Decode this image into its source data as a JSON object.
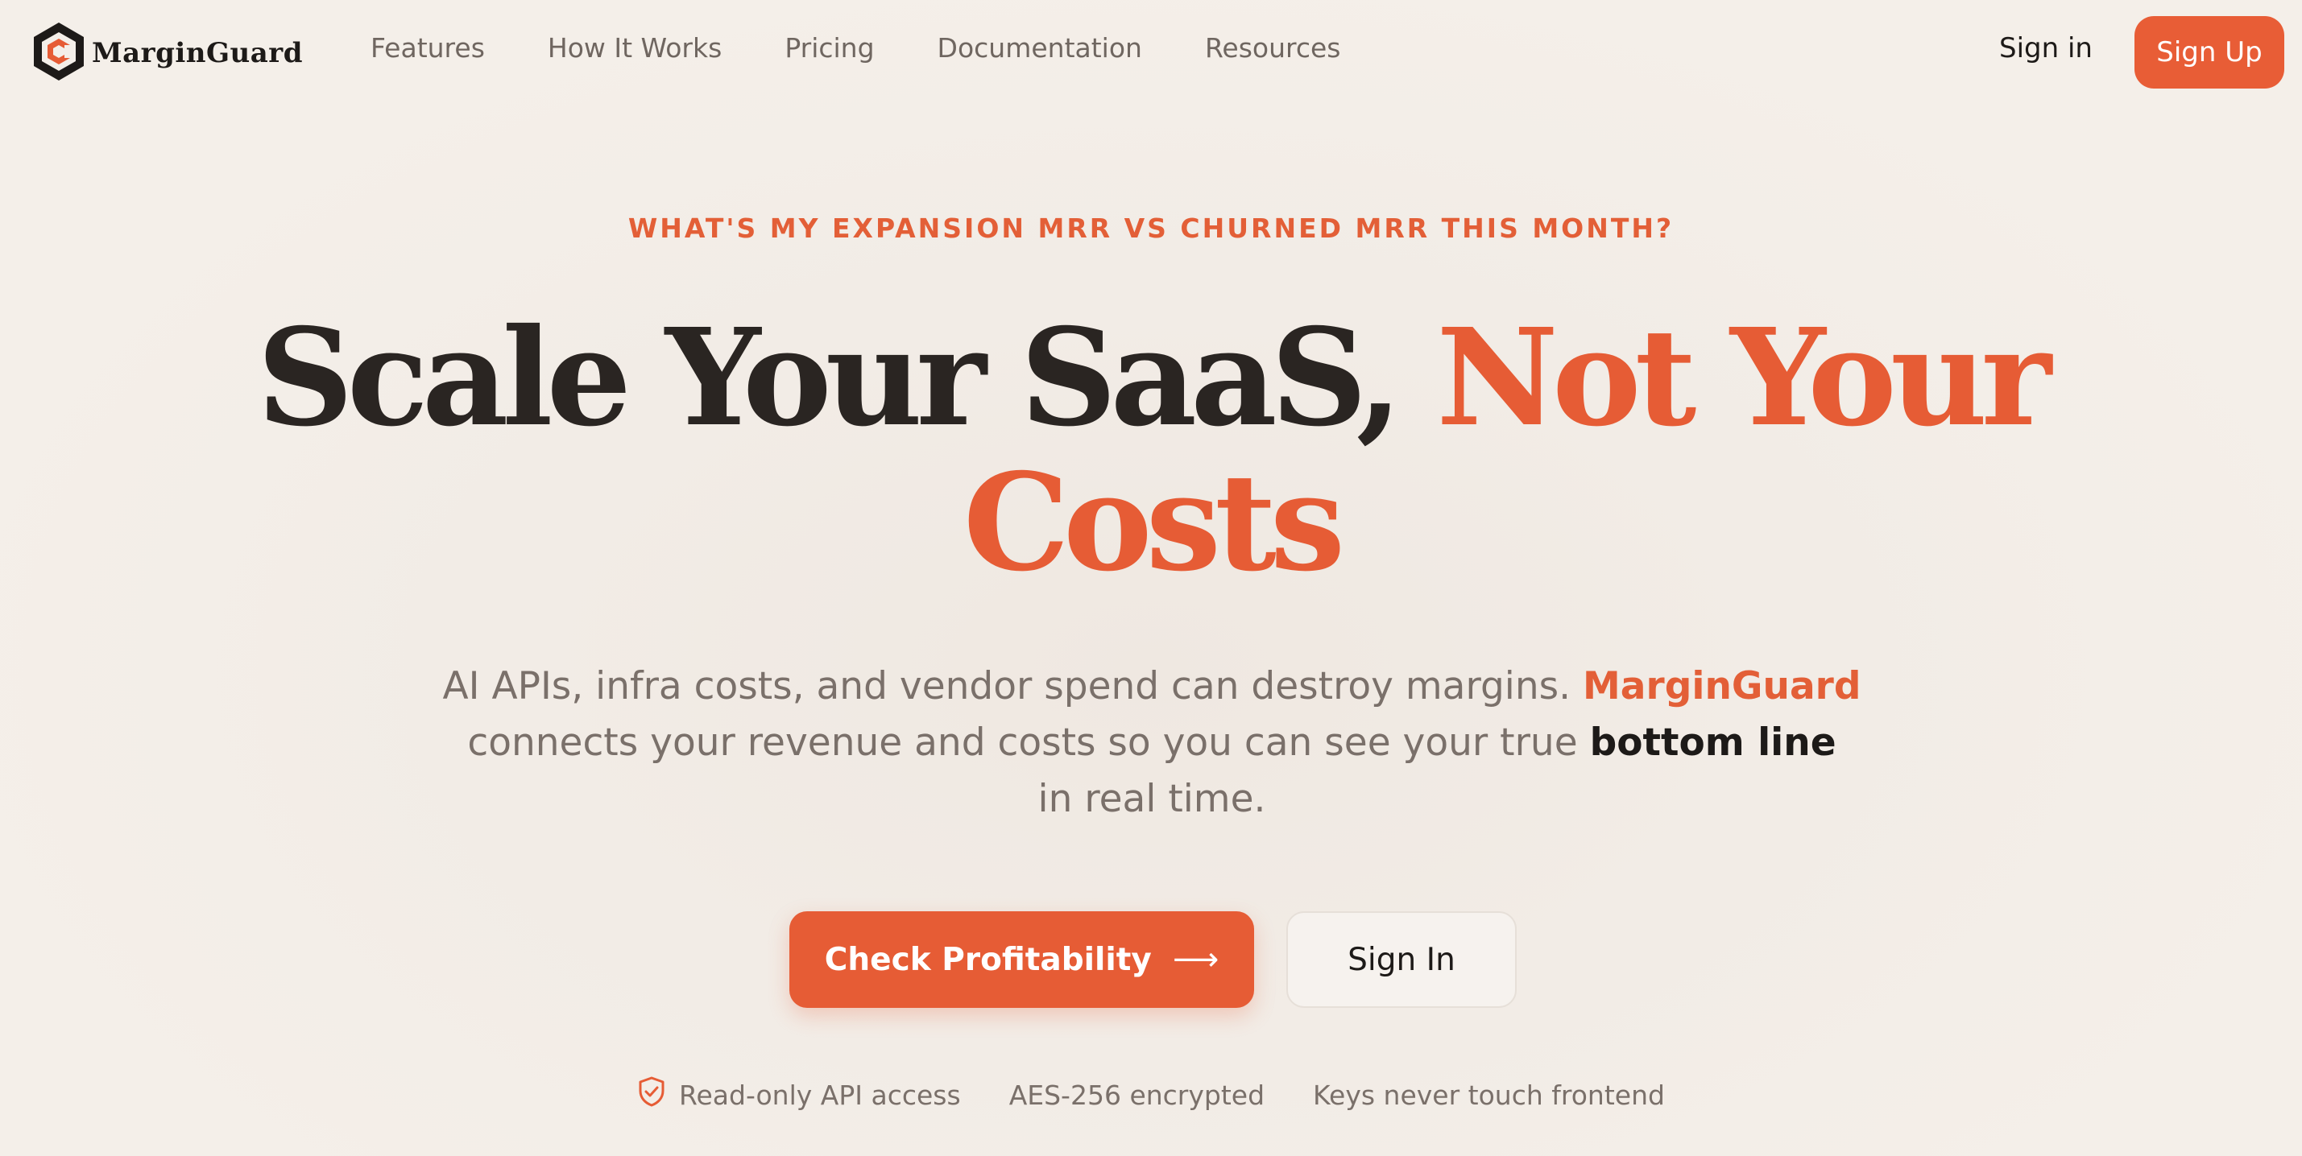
{
  "brand": {
    "name": "MarginGuard",
    "accent_color": "#e65c35",
    "logo_icon": "hexagon-logo-icon"
  },
  "nav": {
    "links": [
      "Features",
      "How It Works",
      "Pricing",
      "Documentation",
      "Resources"
    ],
    "sign_in": "Sign in",
    "sign_up": "Sign Up"
  },
  "hero": {
    "eyebrow": "WHAT'S MY EXPANSION MRR VS CHURNED MRR THIS MONTH?",
    "headline_dark": "Scale Your SaaS,",
    "headline_accent_1": "Not Your",
    "headline_accent_2": "Costs",
    "subtitle_part1": "AI APIs, infra costs, and vendor spend can destroy margins.",
    "subtitle_brand": "MarginGuard",
    "subtitle_part2": "connects your revenue and costs so you can see your true",
    "subtitle_strong": "bottom line",
    "subtitle_part3": "in real time.",
    "cta_primary": "Check Profitability",
    "cta_primary_icon": "arrow-right-icon",
    "cta_secondary": "Sign In"
  },
  "trust": {
    "items": [
      "Read-only API access",
      "AES-256 encrypted",
      "Keys never touch frontend"
    ],
    "icon": "shield-check-icon"
  }
}
